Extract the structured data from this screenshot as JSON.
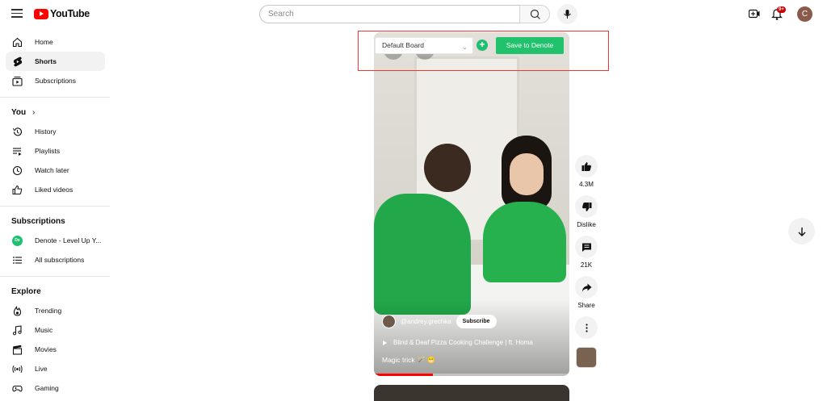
{
  "header": {
    "logo_text": "YouTube",
    "search_placeholder": "Search",
    "notification_count": "9+",
    "avatar_letter": "C"
  },
  "sidebar": {
    "main": [
      {
        "label": "Home",
        "icon": "home-icon"
      },
      {
        "label": "Shorts",
        "icon": "shorts-icon",
        "active": true
      },
      {
        "label": "Subscriptions",
        "icon": "subscriptions-icon"
      }
    ],
    "you_heading": "You",
    "you_items": [
      {
        "label": "History",
        "icon": "history-icon"
      },
      {
        "label": "Playlists",
        "icon": "playlists-icon"
      },
      {
        "label": "Watch later",
        "icon": "clock-icon"
      },
      {
        "label": "Liked videos",
        "icon": "thumbs-up-icon"
      }
    ],
    "subs_heading": "Subscriptions",
    "subs_items": [
      {
        "label": "Denote - Level Up Y...",
        "icon": "denote-channel-icon"
      },
      {
        "label": "All subscriptions",
        "icon": "list-icon"
      }
    ],
    "explore_heading": "Explore",
    "explore_items": [
      {
        "label": "Trending",
        "icon": "fire-icon"
      },
      {
        "label": "Music",
        "icon": "music-icon"
      },
      {
        "label": "Movies",
        "icon": "clapperboard-icon"
      },
      {
        "label": "Live",
        "icon": "live-icon"
      },
      {
        "label": "Gaming",
        "icon": "gamepad-icon"
      }
    ]
  },
  "video": {
    "channel_name": "@andrey.grechka",
    "subscribe_label": "Subscribe",
    "song": "Blind & Deaf Pizza Cooking Challenge | ft. Homa",
    "title": "Magic trick 🪄 😁",
    "progress": 0.3
  },
  "actions": {
    "likes": "4.3M",
    "dislike_label": "Dislike",
    "comments": "21K",
    "share_label": "Share"
  },
  "extension": {
    "board_selected": "Default Board",
    "save_label": "Save to Denote",
    "accent_color": "#22c16b",
    "frame_color": "#e53935"
  },
  "denote_icon_text": "De"
}
